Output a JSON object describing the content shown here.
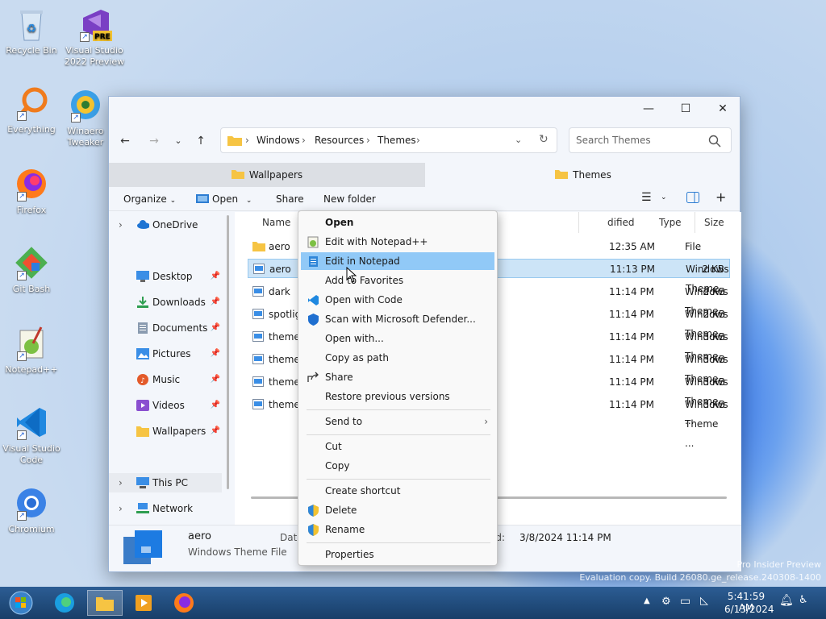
{
  "desktop": {
    "icons": [
      {
        "label": "Recycle Bin"
      },
      {
        "label": "Visual Studio 2022 Preview",
        "badge": "PRE"
      },
      {
        "label": "Everything"
      },
      {
        "label": "Winaero Tweaker"
      },
      {
        "label": "Firefox"
      },
      {
        "label": "Git Bash"
      },
      {
        "label": "Notepad++"
      },
      {
        "label": "Visual Studio Code"
      },
      {
        "label": "Chromium"
      }
    ],
    "watermark_line1": "Pro Insider Preview",
    "watermark_line2": "Evaluation copy. Build 26080.ge_release.240308-1400"
  },
  "explorer": {
    "breadcrumb": [
      "Windows",
      "Resources",
      "Themes"
    ],
    "search_placeholder": "Search Themes",
    "tabs": [
      {
        "label": "Wallpapers"
      },
      {
        "label": "Themes"
      }
    ],
    "toolbar": {
      "organize": "Organize",
      "open": "Open",
      "share": "Share",
      "new_folder": "New folder"
    },
    "nav": {
      "onedrive": "OneDrive",
      "quick": [
        {
          "label": "Desktop",
          "icon": "desktop-icon"
        },
        {
          "label": "Downloads",
          "icon": "downloads-icon"
        },
        {
          "label": "Documents",
          "icon": "documents-icon"
        },
        {
          "label": "Pictures",
          "icon": "pictures-icon"
        },
        {
          "label": "Music",
          "icon": "music-icon"
        },
        {
          "label": "Videos",
          "icon": "videos-icon"
        },
        {
          "label": "Wallpapers",
          "icon": "folder-icon"
        }
      ],
      "this_pc": "This PC",
      "network": "Network"
    },
    "columns": {
      "name": "Name",
      "modified": "dified",
      "type": "Type",
      "size": "Size"
    },
    "files": [
      {
        "name": "aero",
        "time": "12:35 AM",
        "type": "File folder",
        "size": ""
      },
      {
        "name": "aero",
        "time": "11:13 PM",
        "type": "Windows Theme ...",
        "size": "2 KB"
      },
      {
        "name": "dark",
        "time": "11:14 PM",
        "type": "Windows Theme ...",
        "size": "2 KB"
      },
      {
        "name": "spotlig",
        "time": "11:14 PM",
        "type": "Windows Theme ...",
        "size": "2 KB"
      },
      {
        "name": "theme",
        "time": "11:14 PM",
        "type": "Windows Theme ...",
        "size": "3 KB"
      },
      {
        "name": "themel",
        "time": "11:14 PM",
        "type": "Windows Theme ...",
        "size": "3 KB"
      },
      {
        "name": "theme",
        "time": "11:14 PM",
        "type": "Windows Theme ...",
        "size": "3 KB"
      },
      {
        "name": "themel",
        "time": "11:14 PM",
        "type": "Windows Theme ...",
        "size": "3 KB"
      }
    ],
    "status": {
      "name": "aero",
      "type": "Windows Theme File",
      "date_label": "Date",
      "modified_label": "ed:",
      "modified_value": "3/8/2024 11:14 PM"
    }
  },
  "context_menu": {
    "items": [
      {
        "label": "Open"
      },
      {
        "label": "Edit with Notepad++"
      },
      {
        "label": "Edit in Notepad"
      },
      {
        "label": "Add to Favorites"
      },
      {
        "label": "Open with Code"
      },
      {
        "label": "Scan with Microsoft Defender..."
      },
      {
        "label": "Open with..."
      },
      {
        "label": "Copy as path"
      },
      {
        "label": "Share"
      },
      {
        "label": "Restore previous versions"
      },
      {
        "label": "Send to"
      },
      {
        "label": "Cut"
      },
      {
        "label": "Copy"
      },
      {
        "label": "Create shortcut"
      },
      {
        "label": "Delete"
      },
      {
        "label": "Rename"
      },
      {
        "label": "Properties"
      }
    ]
  },
  "taskbar": {
    "time": "5:41:59 AM",
    "date": "6/13/2024"
  }
}
